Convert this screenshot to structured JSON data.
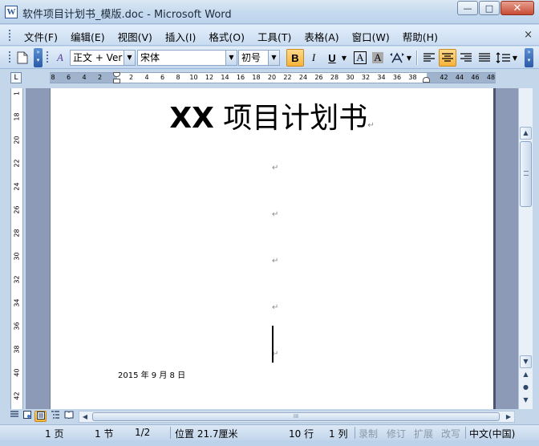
{
  "window": {
    "title": "软件项目计划书_模版.doc - Microsoft Word",
    "app_icon_letter": "W",
    "minimize_glyph": "—",
    "maximize_glyph": "□",
    "close_glyph": "✕"
  },
  "menu": {
    "items": [
      "文件(F)",
      "编辑(E)",
      "视图(V)",
      "插入(I)",
      "格式(O)",
      "工具(T)",
      "表格(A)",
      "窗口(W)",
      "帮助(H)"
    ],
    "close_glyph": "×"
  },
  "toolbar": {
    "style_value": "正文 + Ver",
    "font_value": "宋体",
    "size_value": "初号",
    "bold_label": "B",
    "italic_label": "I",
    "underline_label": "U",
    "styles_icon_label": "A",
    "border_a_label": "A",
    "shade_a_label": "A"
  },
  "ruler": {
    "corner_glyph": "L",
    "ticks": [
      "8",
      "6",
      "4",
      "2",
      "",
      "2",
      "4",
      "6",
      "8",
      "10",
      "12",
      "14",
      "16",
      "18",
      "20",
      "22",
      "24",
      "26",
      "28",
      "30",
      "32",
      "34",
      "36",
      "38",
      "",
      "42",
      "44",
      "46",
      "48"
    ],
    "vticks": [
      "1",
      "18",
      "20",
      "22",
      "24",
      "26",
      "28",
      "30",
      "32",
      "34",
      "36",
      "38",
      "40",
      "42"
    ]
  },
  "document": {
    "title_xx": "XX",
    "title_rest": " 项目计划书",
    "paragraph_mark": "↵",
    "date": "2015 年 9 月 8 日"
  },
  "scrollbar": {
    "up": "▲",
    "down": "▼",
    "prev_page": "▲",
    "select_browse": "●",
    "next_page": "▼"
  },
  "viewbar": {
    "left": "◀",
    "right": "▶",
    "thumb_grip": "III"
  },
  "status": {
    "page": "1 页",
    "section": "1 节",
    "page_of": "1/2",
    "position": "位置 21.7厘米",
    "line": "10 行",
    "column": "1 列",
    "rec": "录制",
    "trk": "修订",
    "ext": "扩展",
    "ovr": "改写",
    "language": "中文(中国)"
  }
}
